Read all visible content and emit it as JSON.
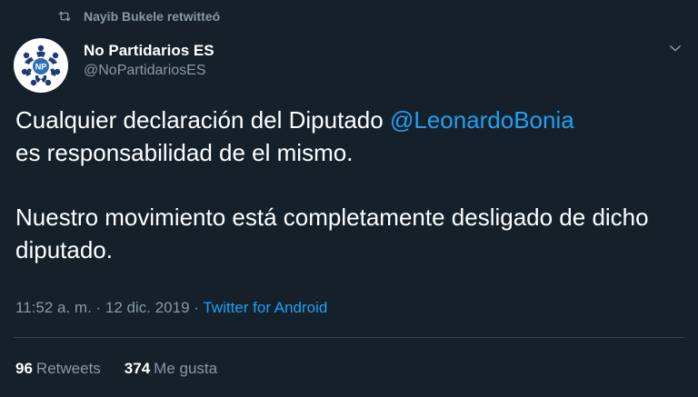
{
  "retweet": {
    "text": "Nayib Bukele retwitteó"
  },
  "author": {
    "display_name": "No Partidarios ES",
    "handle": "@NoPartidariosES",
    "avatar_text": "NP"
  },
  "tweet": {
    "line1_text": "Cualquier declaración del Diputado ",
    "mention": "@LeonardoBonia",
    "line2_text": " es responsabilidad de el mismo.",
    "paragraph2": "Nuestro movimiento está completamente desligado de dicho diputado."
  },
  "meta": {
    "time": "11:52 a. m.",
    "sep1": " · ",
    "date": "12 dic. 2019",
    "sep2": " · ",
    "source": "Twitter for Android"
  },
  "stats": {
    "retweets_count": "96",
    "retweets_label": "Retweets",
    "likes_count": "374",
    "likes_label": "Me gusta"
  },
  "colors": {
    "background": "#15202b",
    "muted": "#8899a6",
    "accent": "#1da1f2",
    "avatar_brand": "#1f3b73"
  },
  "icons": {
    "retweet": "retweet-icon",
    "caret": "chevron-down-icon"
  }
}
